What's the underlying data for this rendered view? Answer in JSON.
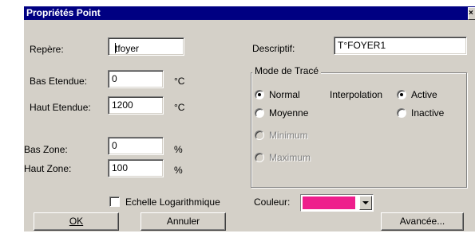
{
  "window": {
    "title": "Propriétés Point",
    "close_glyph": "×"
  },
  "fields": {
    "repere": {
      "label": "Repère:",
      "value": "tfoyer"
    },
    "descriptif": {
      "label": "Descriptif:",
      "value": "T°FOYER1"
    },
    "bas_etendue": {
      "label": "Bas Etendue:",
      "value": "0",
      "unit": "°C"
    },
    "haut_etendue": {
      "label": "Haut Etendue:",
      "value": "1200",
      "unit": "°C"
    },
    "bas_zone": {
      "label": "Bas Zone:",
      "value": "0",
      "unit": "%"
    },
    "haut_zone": {
      "label": "Haut Zone:",
      "value": "100",
      "unit": "%"
    }
  },
  "echelle": {
    "label": "Echelle Logarithmique",
    "checked": false
  },
  "mode_trace": {
    "title": "Mode de Tracé",
    "options": [
      {
        "label": "Normal",
        "selected": true,
        "enabled": true
      },
      {
        "label": "Moyenne",
        "selected": false,
        "enabled": true
      },
      {
        "label": "Minimum",
        "selected": false,
        "enabled": false
      },
      {
        "label": "Maximum",
        "selected": false,
        "enabled": false
      }
    ],
    "interpolation": {
      "label": "Interpolation",
      "options": [
        {
          "label": "Active",
          "selected": true
        },
        {
          "label": "Inactive",
          "selected": false
        }
      ]
    }
  },
  "couleur": {
    "label": "Couleur:",
    "color": "#ee1e8c"
  },
  "buttons": {
    "ok": "OK",
    "annuler": "Annuler",
    "avancee": "Avancée..."
  },
  "colors": {
    "face": "#d4d0c8",
    "titlebar": "#000082"
  }
}
